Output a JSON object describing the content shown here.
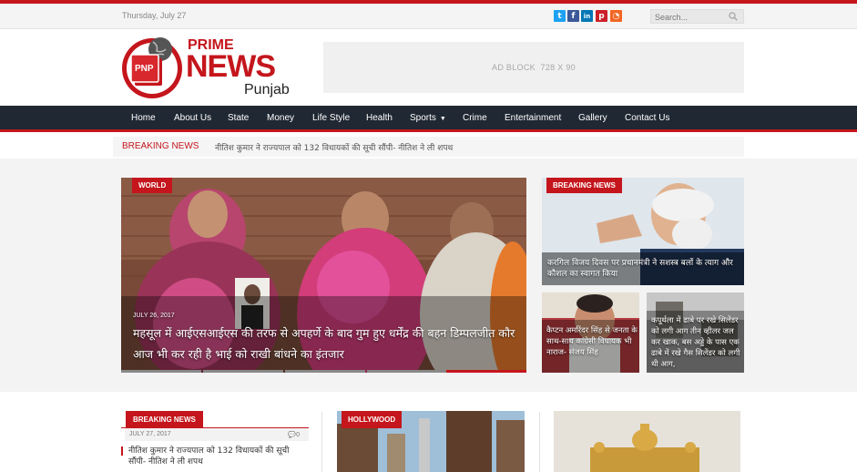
{
  "topbar": {
    "date": "Thursday, July 27",
    "social": [
      {
        "icon": "twitter-icon",
        "glyph": "t",
        "color": "#1da1f2"
      },
      {
        "icon": "facebook-icon",
        "glyph": "f",
        "color": "#3b5998"
      },
      {
        "icon": "linkedin-icon",
        "glyph": "in",
        "color": "#0077b5"
      },
      {
        "icon": "pinterest-icon",
        "glyph": "p",
        "color": "#cb2027"
      },
      {
        "icon": "rss-icon",
        "glyph": "◔",
        "color": "#f26522"
      }
    ],
    "search_placeholder": "Search..."
  },
  "logo": {
    "prime": "PRIME",
    "news": "NEWS",
    "region": "Punjab",
    "badge": "PNP"
  },
  "ad": {
    "text": "AD BLOCK  728 X 90"
  },
  "nav": {
    "items": [
      "Home",
      "About Us",
      "State",
      "Money",
      "Life Style",
      "Health",
      "Sports",
      "Crime",
      "Entertainment",
      "Gallery",
      "Contact Us"
    ]
  },
  "breaking": {
    "label": "BREAKING NEWS",
    "headline": "नीतिश कुमार ने राज्यपाल को 132 विधायकों की सूची सौंपी- नीतिश ने ली शपथ"
  },
  "featured": {
    "main": {
      "tag": "WORLD",
      "date": "JULY 26, 2017",
      "title": "महसूल में आईएसआईएस की तरफ से अपहर्णे के बाद गुम हुए धर्मेंद्र की बहन डिम्पलजीत कौर आज भी कर रही है भाई को राखी बांधने का इंतजार"
    },
    "right_top": {
      "tag": "BREAKING NEWS",
      "title": "करगिल विजय दिवस पर प्रधानमंत्री ने सशस्त्र बलों के त्याग और कौशल का स्वागत किया"
    },
    "right_bottom_left": {
      "title": "कैप्टन अमरिंदर सिंह से जनता के साथ-साथ कांग्रेसी विधायक भी नाराज- संजय सिंह"
    },
    "right_bottom_right": {
      "title": "कपूर्थला में ढाबे पर रखे सिलेंडर को लगी आग तीन व्हीलर जल कर खाक, बस अड्डे के पास एक ढाबे में रखे गैस सिलेंडर को लगी थी आग,"
    }
  },
  "lower": {
    "col1": {
      "tag": "BREAKING NEWS",
      "date": "JULY 27, 2017",
      "comments": "0",
      "title": "नीतिश कुमार ने राज्यपाल को 132 विधायकों की सूची सौंपी- नीतिश ने ली शपथ"
    },
    "col2": {
      "tag": "HOLLYWOOD"
    }
  },
  "colors": {
    "brand_red": "#c4161c",
    "nav_bg": "#202833"
  }
}
